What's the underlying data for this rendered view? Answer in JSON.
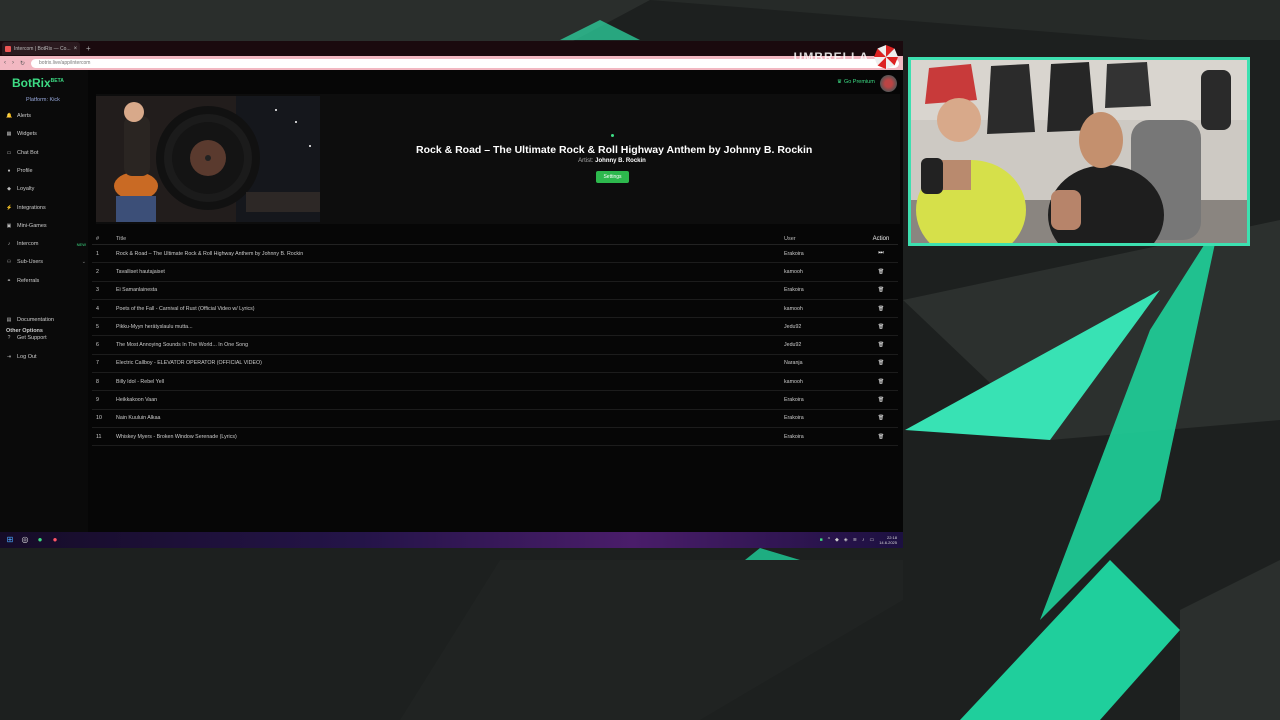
{
  "browser": {
    "tab_title": "Intercom | BotRix — Co...",
    "url": "botrix.live/app/intercom",
    "overlay_text": "UMBRELLA"
  },
  "sidebar": {
    "logo": "BotRix",
    "logo_badge": "BETA",
    "platform": "Platform: Kick",
    "items": [
      {
        "label": "Alerts",
        "icon": "bell-icon"
      },
      {
        "label": "Widgets",
        "icon": "widgets-icon"
      },
      {
        "label": "Chat Bot",
        "icon": "chat-icon"
      },
      {
        "label": "Profile",
        "icon": "user-icon"
      },
      {
        "label": "Loyalty",
        "icon": "loyalty-icon"
      },
      {
        "label": "Integrations",
        "icon": "plug-icon"
      },
      {
        "label": "Mini-Games",
        "icon": "gamepad-icon"
      },
      {
        "label": "Intercom",
        "icon": "music-icon",
        "badge": "NEW"
      },
      {
        "label": "Sub-Users",
        "icon": "users-icon"
      },
      {
        "label": "Referrals",
        "icon": "referrals-icon"
      }
    ],
    "other_heading": "Other Options",
    "other_items": [
      {
        "label": "Documentation",
        "icon": "doc-icon"
      },
      {
        "label": "Get Support",
        "icon": "support-icon"
      },
      {
        "label": "Log Out",
        "icon": "logout-icon"
      }
    ]
  },
  "header": {
    "premium": "Go Premium"
  },
  "now_playing": {
    "title": "Rock & Road – The Ultimate Rock & Roll Highway Anthem by Johnny B. Rockin",
    "artist_label": "Artist:",
    "artist": "Johnny B. Rockin",
    "settings_button": "Settings"
  },
  "queue": {
    "columns": [
      "#",
      "Title",
      "User",
      "Action"
    ],
    "rows": [
      {
        "n": "1",
        "title": "Rock & Road – The Ultimate Rock & Roll Highway Anthem by Johnny B. Rockin",
        "user": "Erakoira",
        "action": "skip"
      },
      {
        "n": "2",
        "title": "Tavalliset hautajaiset",
        "user": "kamooh",
        "action": "delete"
      },
      {
        "n": "3",
        "title": "Ei Samanlainesta",
        "user": "Erakoira",
        "action": "delete"
      },
      {
        "n": "4",
        "title": "Poets of the Fall - Carnival of Rust (Official Video w/ Lyrics)",
        "user": "kamooh",
        "action": "delete"
      },
      {
        "n": "5",
        "title": "Pikku-Myyn herätyslaulu mutta...",
        "user": "Jedu92",
        "action": "delete"
      },
      {
        "n": "6",
        "title": "The Most Annoying Sounds In The World... In One Song",
        "user": "Jedu92",
        "action": "delete"
      },
      {
        "n": "7",
        "title": "Electric Callboy - ELEVATOR OPERATOR (OFFICIAL VIDEO)",
        "user": "Naranja",
        "action": "delete"
      },
      {
        "n": "8",
        "title": "Billy Idol - Rebel Yell",
        "user": "kamooh",
        "action": "delete"
      },
      {
        "n": "9",
        "title": "Heikkakoon Vaan",
        "user": "Erakoira",
        "action": "delete"
      },
      {
        "n": "10",
        "title": "Nain Kuuluin Alkaa",
        "user": "Erakoira",
        "action": "delete"
      },
      {
        "n": "11",
        "title": "Whiskey Myers - Broken Window Serenade (Lyrics)",
        "user": "Erakoira",
        "action": "delete"
      }
    ]
  },
  "taskbar": {
    "time": "22:18",
    "date": "14.6.2025"
  },
  "colors": {
    "accent": "#3ddc84",
    "cam_border": "#3de0b0",
    "button": "#2db84d"
  }
}
